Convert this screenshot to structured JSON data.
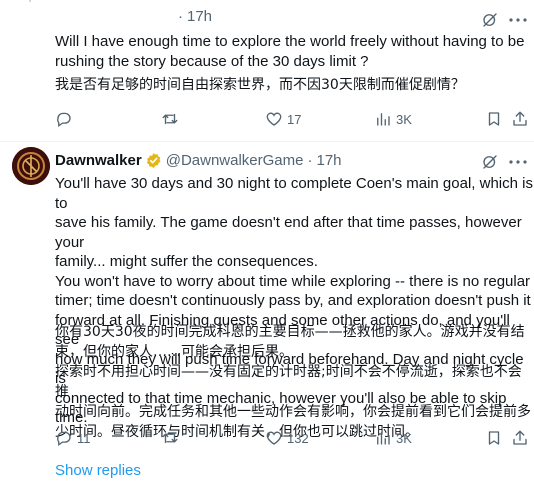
{
  "post1": {
    "time": "17h",
    "text_en": [
      "Will I have enough time to explore the world freely without having to be",
      "rushing the story because of the 30 days limit ?"
    ],
    "text_zh": "我是否有足够的时间自由探索世界，而不因30天限制而催促剧情？",
    "actions": {
      "replies": "",
      "reposts": "",
      "likes": "17",
      "views": "3K"
    }
  },
  "post2": {
    "name": "Dawnwalker",
    "handle": "@DawnwalkerGame",
    "separator": "·",
    "time": "17h",
    "text_en": [
      "You'll have 30 days and 30 night to complete Coen's main goal, which is to",
      "save his family. The game doesn't end after that time passes, however your",
      "family... might suffer the consequences.",
      "You won't have to worry about time while exploring -- there is no regular",
      "timer; time doesn't continuously pass by, and exploration doesn't push it",
      "forward at all. Finishing quests and some other actions do, and you'll see",
      "how much they will push time forward beforehand. Day and night cycle is",
      "connected to that time mechanic, however you'll also be able to skip time."
    ],
    "text_zh": [
      "你有30天30夜的时间完成科恩的主要目标——拯救他的家人。游戏并没有结",
      "束，但你的家人……可能会承担后果。",
      "探索时不用担心时间——没有固定的计时器;时间不会不停流逝，探索也不会推",
      "动时间向前。完成任务和其他一些动作会有影响，你会提前看到它们会提前多",
      "少时间。昼夜循环与时间机制有关，但你也可以跳过时间。"
    ],
    "actions": {
      "replies": "11",
      "reposts": "",
      "likes": "132",
      "views": "3K"
    }
  },
  "show_replies": "Show replies",
  "colors": {
    "text": "#0f1419",
    "muted": "#536471",
    "link": "#1d9bf0",
    "verified": "#e2b719",
    "divider": "#eff3f4"
  }
}
